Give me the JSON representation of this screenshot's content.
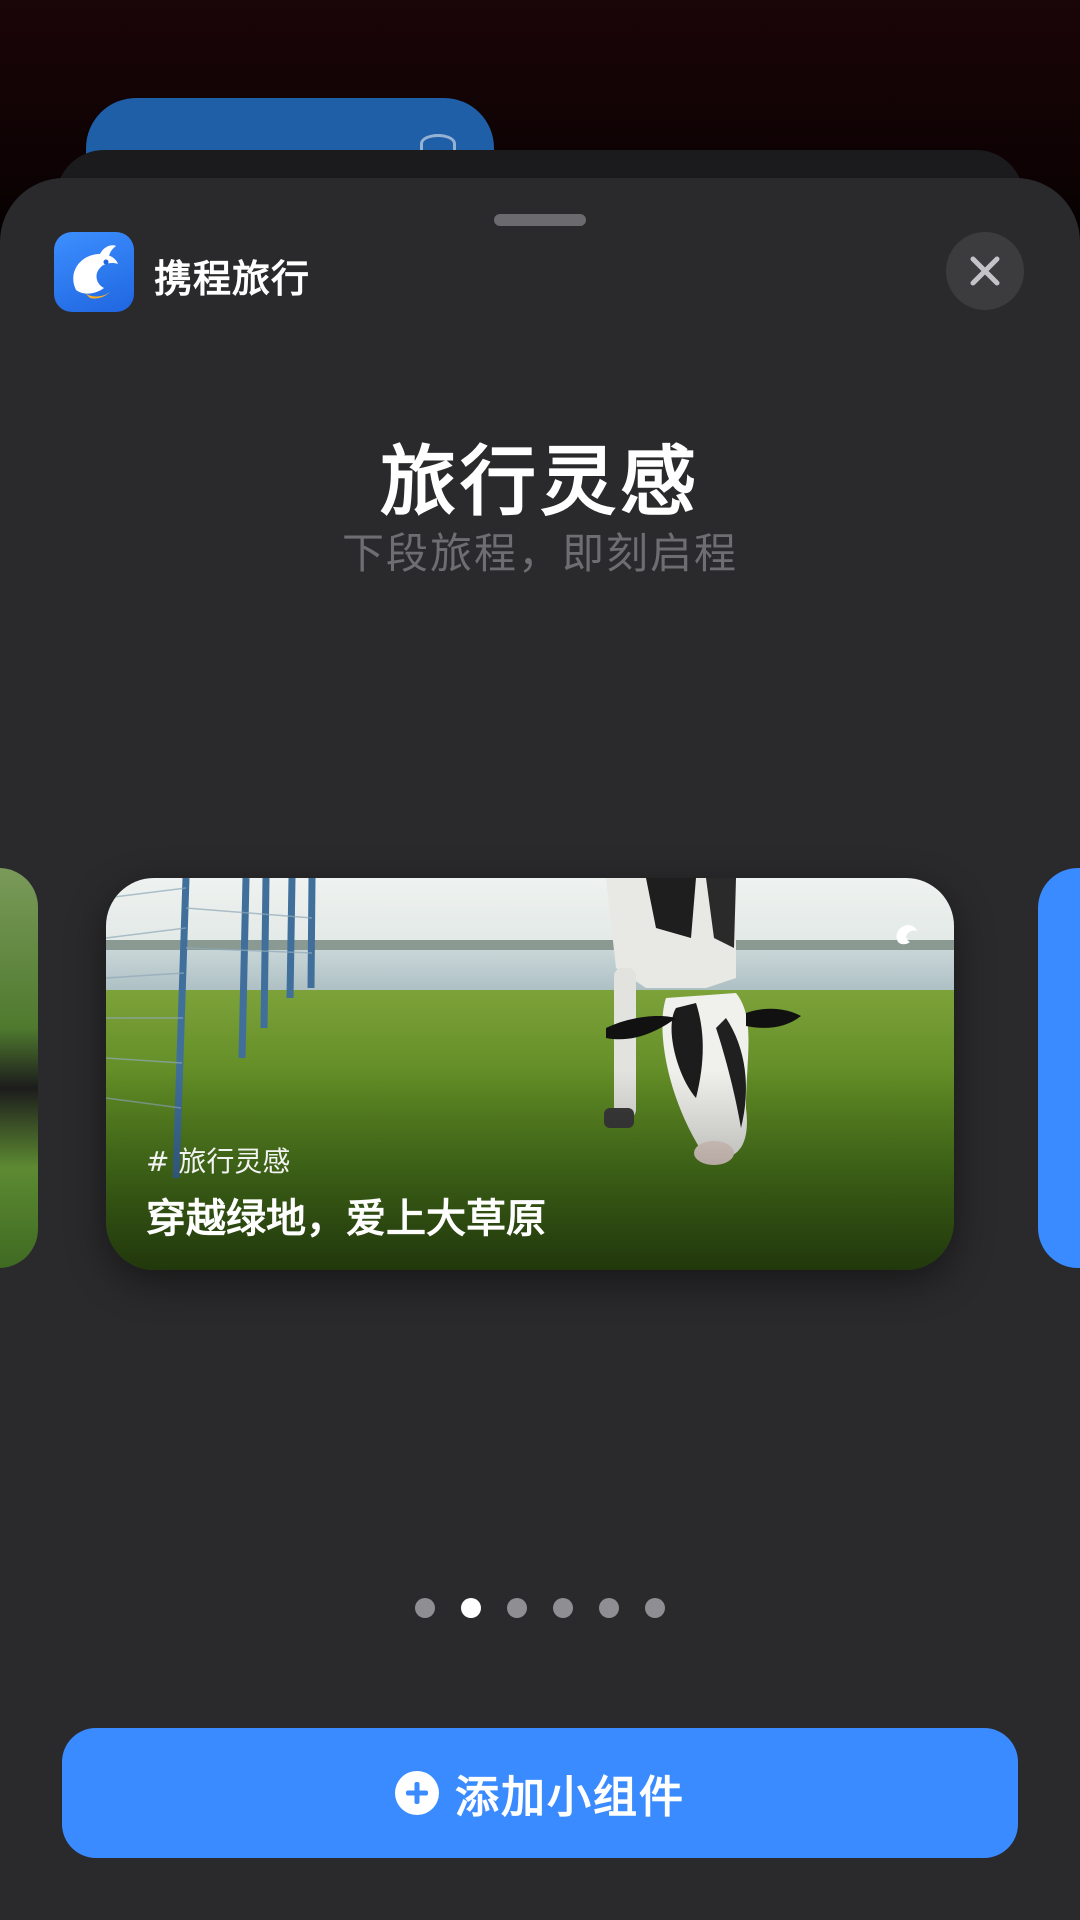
{
  "app": {
    "name": "携程旅行",
    "icon": "ctrip-dolphin-icon"
  },
  "widget_gallery": {
    "title": "旅行灵感",
    "subtitle": "下段旅程，即刻启程",
    "close_icon": "close-icon"
  },
  "widget": {
    "tag": "# 旅行灵感",
    "caption": "穿越绿地，爱上大草原",
    "corner_icon": "ctrip-dolphin-icon"
  },
  "pagination": {
    "total": 6,
    "active_index": 1
  },
  "add_button": {
    "label": "添加小组件",
    "icon": "plus-circle-icon"
  },
  "colors": {
    "sheet": "#2a2a2c",
    "accent": "#3a8bff",
    "close_bg": "#3c3c3f"
  }
}
